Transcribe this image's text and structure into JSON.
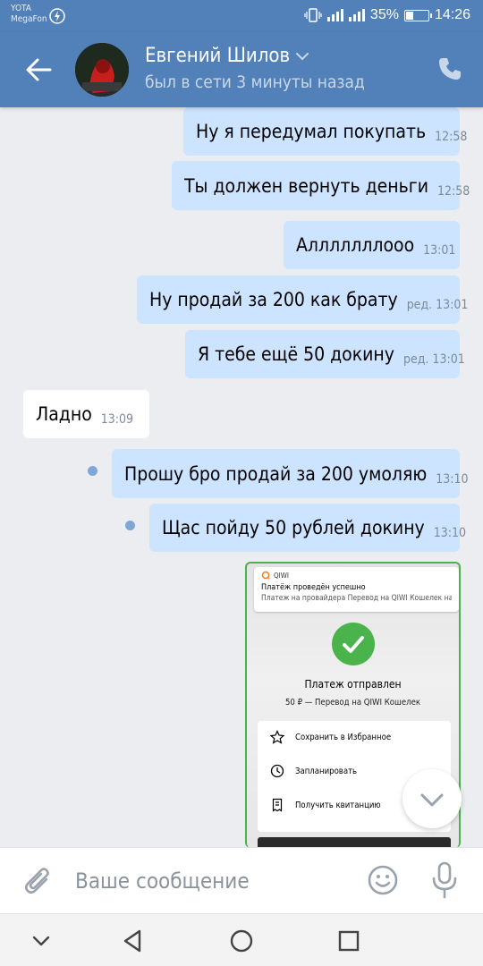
{
  "status_bar": {
    "carrier_1": "YOTA",
    "carrier_2": "MegaFon",
    "battery_percent": "35%",
    "battery_level": 0.35,
    "time": "14:26"
  },
  "header": {
    "contact_name": "Евгений Шилов",
    "last_seen": "был в сети 3 минуты назад"
  },
  "messages": [
    {
      "direction": "out",
      "text": "Ну я передумал покупать",
      "time": "12:58"
    },
    {
      "direction": "out",
      "text": "Ты должен вернуть деньги",
      "time": "12:58"
    },
    {
      "direction": "out",
      "text": "Алллллллооо",
      "time": "13:01"
    },
    {
      "direction": "out",
      "text": "Ну продай за 200 как брату",
      "time": "ред. 13:01"
    },
    {
      "direction": "out",
      "text": "Я тебе ещё 50 докину",
      "time": "ред. 13:01"
    },
    {
      "direction": "in",
      "text": "Ладно",
      "time": "13:09"
    },
    {
      "direction": "out",
      "text": "Прошу бро продай за 200 умоляю",
      "time": "13:10",
      "unread": true
    },
    {
      "direction": "out",
      "text": "Щас пойду 50 рублей докину",
      "time": "13:10",
      "unread": true
    }
  ],
  "image_message": {
    "notification_app": "QIWI",
    "notification_title": "Платёж проведён успешно",
    "notification_text": "Платеж на провайдера Перевод на QIWI Кошелек на сумму...",
    "title": "Платеж отправлен",
    "subtitle": "50 ₽ — Перевод на QIWI Кошелек",
    "actions": [
      "Сохранить в Избранное",
      "Запланировать",
      "Получить квитанцию"
    ]
  },
  "composer": {
    "placeholder": "Ваше сообщение"
  },
  "colors": {
    "header": "#5181b8",
    "outgoing_bubble": "#cce4ff",
    "incoming_bubble": "#ffffff",
    "background": "#ebedf0",
    "success": "#4bb34b"
  }
}
